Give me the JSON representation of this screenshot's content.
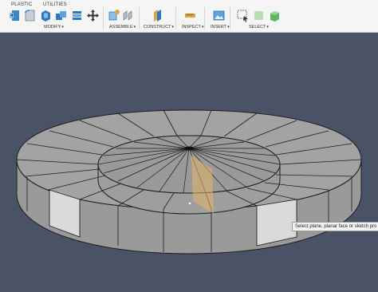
{
  "tabs": [
    {
      "label": "PLASTIC"
    },
    {
      "label": "UTILITIES"
    }
  ],
  "groups": [
    {
      "label": "MODIFY",
      "caret": "▾"
    },
    {
      "label": "ASSEMBLE",
      "caret": "▾"
    },
    {
      "label": "CONSTRUCT",
      "caret": "▾"
    },
    {
      "label": "INSPECT",
      "caret": "▾"
    },
    {
      "label": "INSERT",
      "caret": "▾"
    },
    {
      "label": "SELECT",
      "caret": "▾"
    }
  ],
  "tools": {
    "modify": [
      "press-pull-icon",
      "fillet-icon",
      "shell-icon",
      "combine-icon",
      "move-icon"
    ],
    "assemble": [
      "new-component-icon",
      "joint-icon"
    ],
    "construct": [
      "offset-plane-icon"
    ],
    "inspect": [
      "measure-icon"
    ],
    "insert": [
      "insert-image-icon"
    ],
    "select": [
      "window-select-icon",
      "paint-select-icon",
      "select-priority-icon"
    ]
  },
  "tooltip": "Select plane, planar face or sketch pro",
  "colors": {
    "toolbar_bg": "#f5f5f5",
    "viewport_bg": "#4a5366",
    "model_face": "#a9a9a9",
    "model_edge": "#1e1e1e",
    "highlight_face": "#dcdcdc",
    "plane_preview": "#e8b76a"
  }
}
